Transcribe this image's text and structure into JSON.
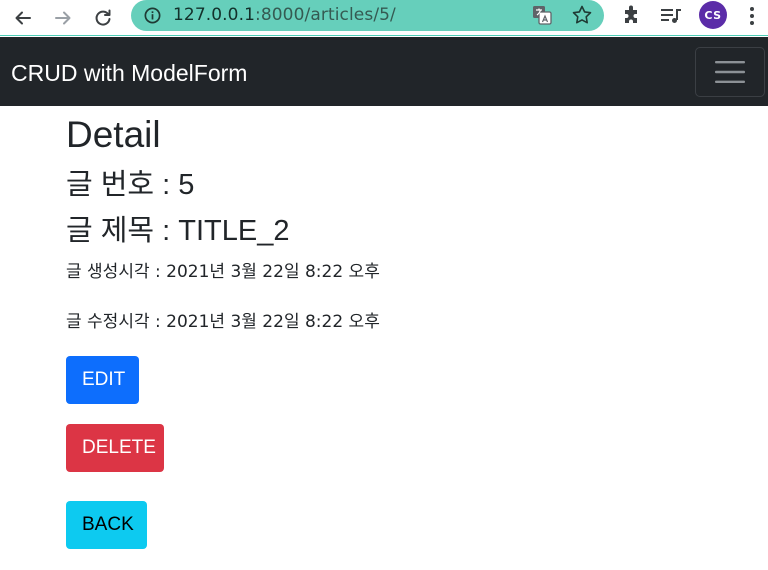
{
  "browser": {
    "url_host": "127.0.0.1",
    "url_rest": ":8000/articles/5/",
    "profile_initials": "CS",
    "icons": {
      "back": "arrow-left-icon",
      "forward": "arrow-right-icon",
      "reload": "reload-icon",
      "site_info": "info-icon",
      "translate": "translate-icon",
      "bookmark": "star-icon",
      "extensions": "puzzle-icon",
      "media": "playlist-icon",
      "menu": "more-vertical-icon"
    },
    "colors": {
      "omnibox": "#66cfbb",
      "avatar": "#5b2ca8"
    }
  },
  "navbar": {
    "brand": "CRUD with ModelForm",
    "toggler_icon": "hamburger-icon",
    "background": "#212529"
  },
  "article": {
    "heading": "Detail",
    "number_line": "글 번호 : 5",
    "title_line": "글 제목 : TITLE_2",
    "created_line": "글 생성시각 : 2021년 3월 22일 8:22 오후",
    "updated_line": "글 수정시각 : 2021년 3월 22일 8:22 오후"
  },
  "actions": {
    "edit_label": "EDIT",
    "delete_label": "DELETE",
    "back_label": "BACK",
    "colors": {
      "edit": "#0d6efd",
      "delete": "#dc3545",
      "back": "#0dcaf0"
    }
  }
}
